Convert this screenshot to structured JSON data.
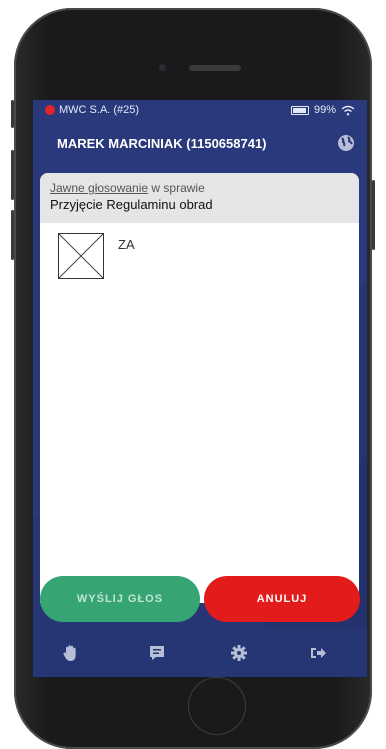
{
  "status": {
    "carrier": "MWC S.A. (#25)",
    "battery": "99%"
  },
  "header": {
    "title": "MAREK MARCINIAK (1150658741)"
  },
  "vote": {
    "type_link": "Jawne głosowanie",
    "type_rest": " w sprawie",
    "subject": "Przyjęcie Regulaminu obrad",
    "option_label": "ZA"
  },
  "buttons": {
    "send": "WYŚLIJ GŁOS",
    "cancel": "ANULUJ"
  },
  "colors": {
    "screen_bg": "#263675",
    "send": "#37a474",
    "cancel": "#e21b1b"
  }
}
